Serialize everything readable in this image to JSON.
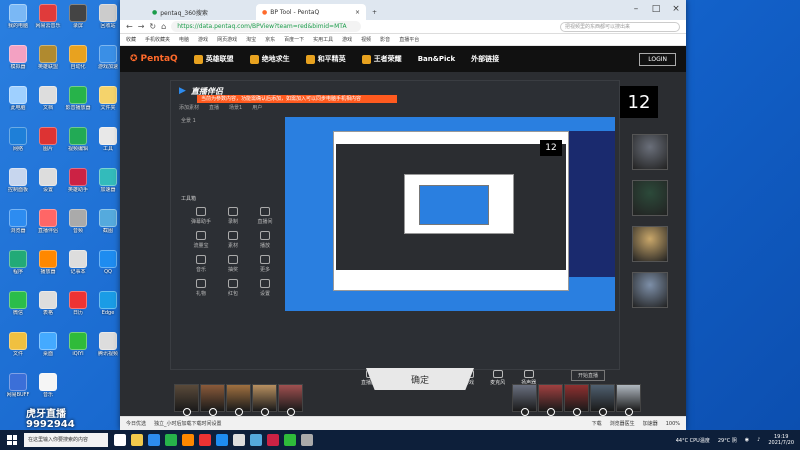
{
  "desktop": {
    "icons": [
      {
        "label": "我的电脑",
        "color": "#7ab8f5"
      },
      {
        "label": "网易云音乐",
        "color": "#e03b3b"
      },
      {
        "label": "录屏",
        "color": "#444"
      },
      {
        "label": "回收站",
        "color": "#ccc"
      },
      {
        "label": "模拟器",
        "color": "#f3a1c2"
      },
      {
        "label": "英雄联盟",
        "color": "#b08a2f"
      },
      {
        "label": "自动化",
        "color": "#e8a21f"
      },
      {
        "label": "游戏加速",
        "color": "#3a8fe6"
      },
      {
        "label": "此电脑",
        "color": "#9fd0ff"
      },
      {
        "label": "文档",
        "color": "#ddd"
      },
      {
        "label": "影音播放器",
        "color": "#27b34a"
      },
      {
        "label": "文件夹",
        "color": "#f5d36b"
      },
      {
        "label": "网络",
        "color": "#1e7fd8"
      },
      {
        "label": "图片",
        "color": "#d33"
      },
      {
        "label": "视频编辑",
        "color": "#2a5"
      },
      {
        "label": "工具",
        "color": "#e8e8e8"
      },
      {
        "label": "控制面板",
        "color": "#c7d6ee"
      },
      {
        "label": "设置",
        "color": "#ddd"
      },
      {
        "label": "英雄助手",
        "color": "#c24"
      },
      {
        "label": "加速器",
        "color": "#3bb"
      },
      {
        "label": "浏览器",
        "color": "#2d8cf0"
      },
      {
        "label": "直播伴侣",
        "color": "#f66"
      },
      {
        "label": "音频",
        "color": "#aaa"
      },
      {
        "label": "截图",
        "color": "#5ad"
      },
      {
        "label": "程序",
        "color": "#2a7"
      },
      {
        "label": "播放器",
        "color": "#f80"
      },
      {
        "label": "记事本",
        "color": "#ddd"
      },
      {
        "label": "QQ",
        "color": "#1e8cf0"
      },
      {
        "label": "微信",
        "color": "#2bbd4a"
      },
      {
        "label": "表格",
        "color": "#ddd"
      },
      {
        "label": "日历",
        "color": "#e33"
      },
      {
        "label": "Edge",
        "color": "#1a9ce6"
      },
      {
        "label": "文件",
        "color": "#f0c040"
      },
      {
        "label": "桌面",
        "color": "#4af"
      },
      {
        "label": "iQIYI",
        "color": "#2fbb3a"
      },
      {
        "label": "腾讯视频",
        "color": "#ddd"
      },
      {
        "label": "网易BUFF",
        "color": "#3b6fd8"
      },
      {
        "label": "音乐",
        "color": "#f5f5f5"
      }
    ]
  },
  "browser": {
    "tabs": [
      {
        "label": "pentaq_360搜索",
        "active": false
      },
      {
        "label": "BP Tool - PentaQ",
        "active": true
      }
    ],
    "url": "https://data.pentaq.com/BPView?team=red&bimid=MTA",
    "search_placeholder": "把视频里的东西都可以搜出来",
    "bookmarks": [
      "收藏",
      "手机收藏夹",
      "电脑",
      "游戏",
      "网页游戏",
      "淘宝",
      "京东",
      "百度一下",
      "实用工具",
      "游戏",
      "视频",
      "影音",
      "直播平台"
    ],
    "status_left": "今日优选",
    "status_mid": "独立_小时后加载下载时间设置",
    "status_items": [
      "下载",
      "浏览器医生",
      "加速器",
      "100%"
    ]
  },
  "pentaq": {
    "logo": "PentaQ",
    "menu": [
      "英雄联盟",
      "绝地求生",
      "和平精英",
      "王者荣耀",
      "Ban&Pick",
      "外部链接"
    ],
    "login": "LOGIN",
    "score": "12",
    "confirm": "确定",
    "champ_colors": [
      "#6a6f7a",
      "#2c4a3a",
      "#c9a76a",
      "#7d8fa8"
    ]
  },
  "stream": {
    "app_title": "直播伴侣",
    "notice": "当前为参数内容，功能需确认后添加，如需加入可以同步电脑手机相内容",
    "ctrl_items": [
      "添加素材",
      "直播",
      "场景1",
      "用户"
    ],
    "left_label": "全景 1",
    "section_label": "工具箱",
    "tools": [
      "弹幕助手",
      "录制",
      "直播间",
      "流量宝",
      "素材",
      "播放",
      "音乐",
      "抽奖",
      "更多",
      "礼物",
      "红包",
      "设置"
    ],
    "bottom_buttons": [
      "直播画面",
      "摄像头",
      "手机投屏",
      "游戏",
      "麦克风",
      "扬声器"
    ],
    "share": "开始直播",
    "status": "码率 0kbps   CPU 20%   FPS 30"
  },
  "bans": {
    "left_colors": [
      "#5a4a3a",
      "#8a5a3a",
      "#a07040",
      "#b89060",
      "#a05050"
    ],
    "right_colors": [
      "#6a7080",
      "#a04040",
      "#903030",
      "#506070",
      "#b0b8c0"
    ]
  },
  "watermark": {
    "line1": "虎牙直播",
    "line2": "9992944"
  },
  "taskbar": {
    "search_placeholder": "在这里输入你要搜索的内容",
    "app_colors": [
      "#fff",
      "#f2c94c",
      "#2d8cf0",
      "#27b34a",
      "#f80",
      "#e33",
      "#1e8cf0",
      "#ddd",
      "#5ad",
      "#c24",
      "#2fbb3a",
      "#aaa"
    ],
    "weather": "29°C 阴",
    "temp": "44°C CPU温度",
    "time": "19:19",
    "date": "2021/7/20"
  }
}
